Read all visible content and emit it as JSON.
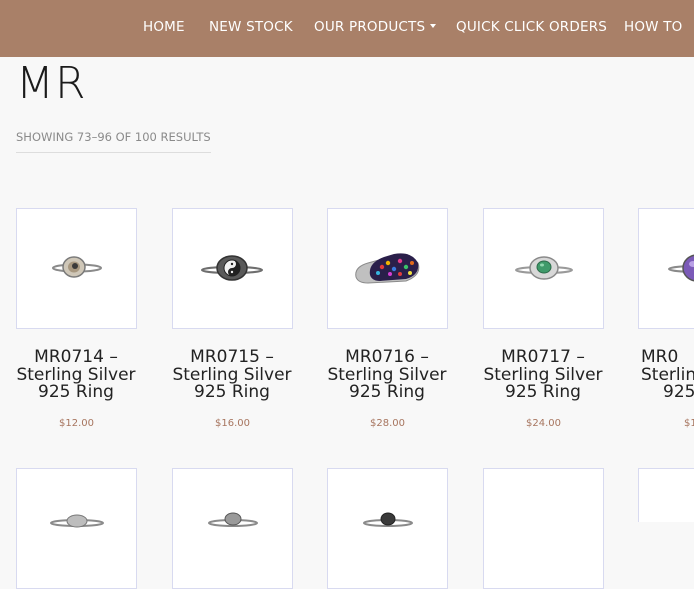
{
  "nav": {
    "items": [
      {
        "label": "HOME"
      },
      {
        "label": "NEW STOCK"
      },
      {
        "label": "OUR PRODUCTS"
      },
      {
        "label": "QUICK CLICK ORDERS"
      },
      {
        "label": "HOW TO"
      }
    ]
  },
  "page": {
    "title": "MR",
    "result_count": "SHOWING 73–96 OF 100 RESULTS"
  },
  "products": [
    {
      "line1": "MR0714 –",
      "line2": "Sterling Silver",
      "line3": "925 Ring",
      "price": "$12.00",
      "image_icon": "shell-eye-ring"
    },
    {
      "line1": "MR0715 –",
      "line2": "Sterling Silver",
      "line3": "925 Ring",
      "price": "$16.00",
      "image_icon": "yin-yang-ring"
    },
    {
      "line1": "MR0716 –",
      "line2": "Sterling Silver",
      "line3": "925 Ring",
      "price": "$28.00",
      "image_icon": "multicolor-stone-ring"
    },
    {
      "line1": "MR0717 –",
      "line2": "Sterling Silver",
      "line3": "925 Ring",
      "price": "$24.00",
      "image_icon": "green-stone-ring"
    },
    {
      "line1": "MR0",
      "line2": "Sterlin",
      "line3": "925",
      "price": "$1",
      "image_icon": "purple-stone-ring"
    }
  ],
  "colors": {
    "nav_background": "#a98068",
    "price": "#a7755f",
    "thumb_border": "#d8daf0"
  }
}
